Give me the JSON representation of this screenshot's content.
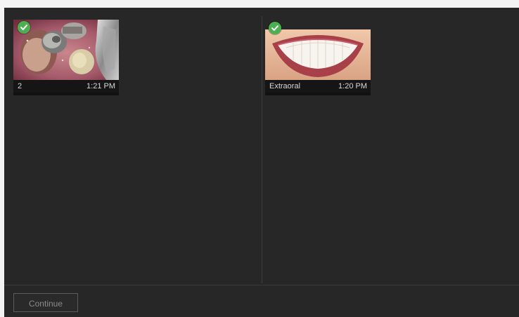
{
  "left_pane": {
    "thumbnail": {
      "name": "2",
      "time": "1:21 PM",
      "selected": true,
      "image": "intraoral-tooth-photo",
      "check_color": "#4caf50"
    }
  },
  "right_pane": {
    "thumbnail": {
      "name": "Extraoral",
      "time": "1:20 PM",
      "selected": true,
      "image": "smile-photo",
      "check_color": "#4caf50"
    }
  },
  "footer": {
    "continue_label": "Continue",
    "continue_enabled": false
  },
  "colors": {
    "background": "#272727",
    "caption_bar": "#151515",
    "accent_check": "#4caf50"
  }
}
